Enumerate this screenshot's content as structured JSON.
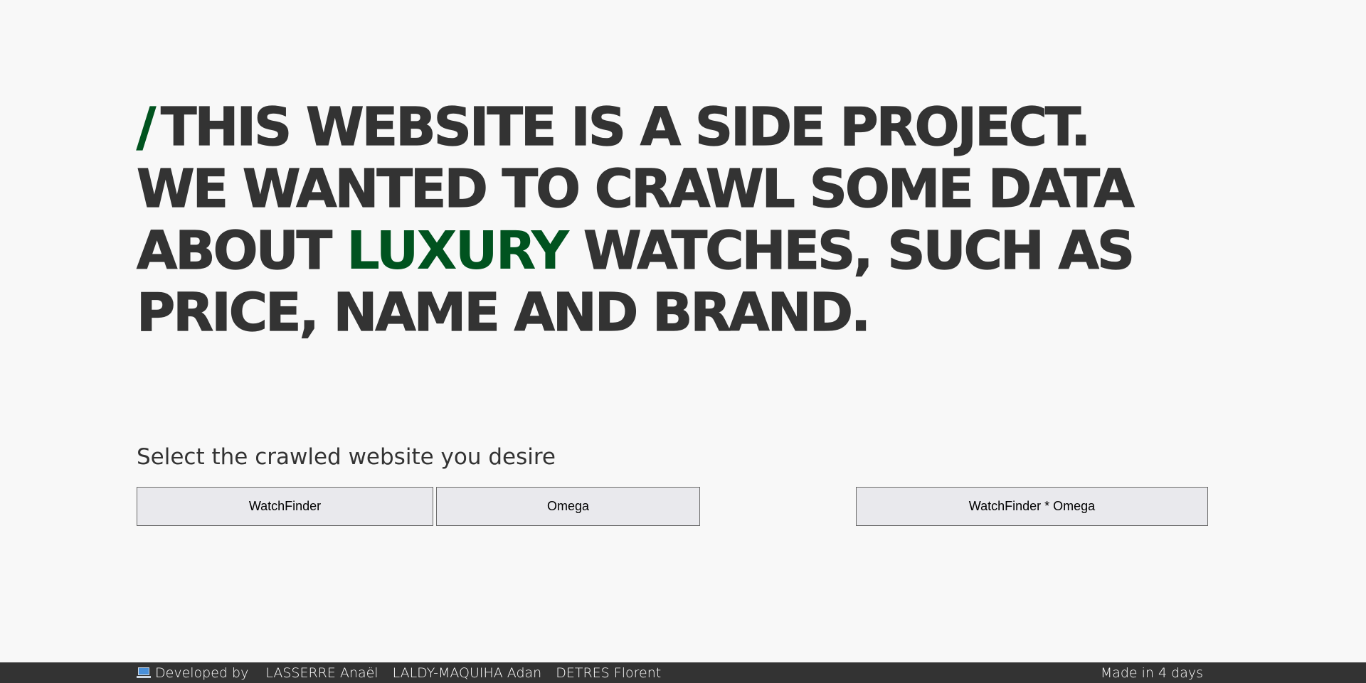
{
  "hero": {
    "slash": "/",
    "line1": "THIS WEBSITE IS A SIDE PROJECT.",
    "line2": "WE WANTED TO CRAWL SOME DATA",
    "line3_before": "ABOUT",
    "line3_accent": "LUXURY",
    "line3_after": "WATCHES, SUCH AS",
    "line4": "PRICE, NAME AND BRAND."
  },
  "selector": {
    "title": "Select the crawled website you desire",
    "buttons": [
      "WatchFinder",
      "Omega",
      "WatchFinder * Omega"
    ]
  },
  "footer": {
    "icon": "laptop-icon",
    "developed_by": "Developed by",
    "authors": [
      "LASSERRE Anaël",
      "LALDY-MAQUIHA Adan",
      "DETRES Florent"
    ],
    "made_in": "Made in 4 days"
  },
  "colors": {
    "accent": "#00531f",
    "text": "#333333",
    "background": "#f8f8f8",
    "footer_bg": "#333333"
  }
}
